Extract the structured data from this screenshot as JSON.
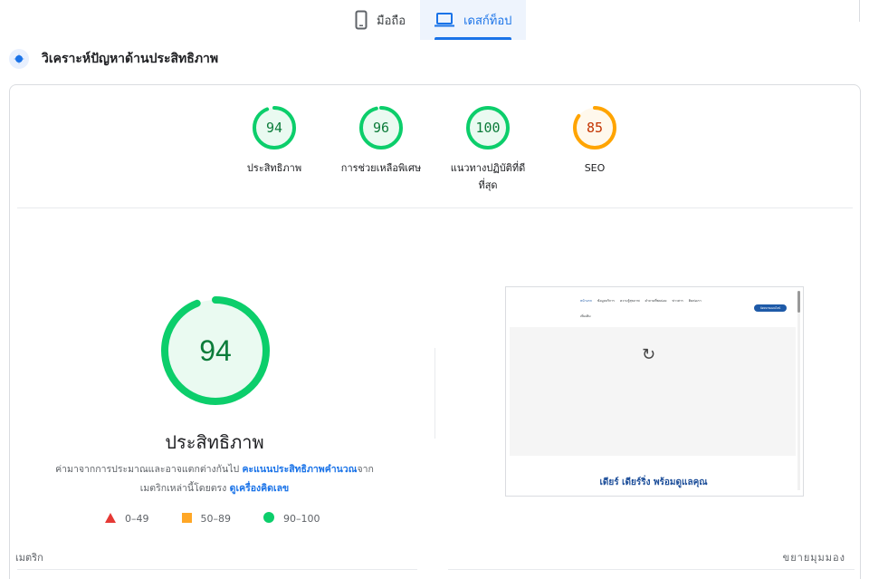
{
  "tabs": [
    {
      "label": "มือถือ",
      "icon": "smartphone-icon",
      "active": false
    },
    {
      "label": "เดสก์ท็อป",
      "icon": "laptop-icon",
      "active": true
    }
  ],
  "section": {
    "title": "วิเคราะห์ปัญหาด้านประสิทธิภาพ",
    "icon": "diagnostics-icon"
  },
  "categories": [
    {
      "score": "94",
      "label": "ประสิทธิภาพ",
      "value": 94,
      "color": "#0cce6b",
      "text_color": "#0c7c3a"
    },
    {
      "score": "96",
      "label": "การช่วยเหลือพิเศษ",
      "value": 96,
      "color": "#0cce6b",
      "text_color": "#0c7c3a"
    },
    {
      "score": "100",
      "label_line1": "แนวทางปฏิบัติที่ดี",
      "label_line2": "ที่สุด",
      "value": 100,
      "color": "#0cce6b",
      "text_color": "#0c7c3a"
    },
    {
      "score": "85",
      "label": "SEO",
      "value": 85,
      "color": "#ffa400",
      "text_color": "#c33300"
    }
  ],
  "performance": {
    "score": "94",
    "value": 94,
    "title": "ประสิทธิภาพ",
    "desc_part1": "ค่ามาจากการประมาณและอาจแตกต่างกันไป ",
    "desc_link1": "คะแนนประสิทธิภาพคำนวณ",
    "desc_part2": "จาก",
    "desc_part3": "เมตริกเหล่านี้โดยตรง ",
    "desc_link2": "ดูเครื่องคิดเลข"
  },
  "legend": [
    {
      "range": "0–49",
      "shape": "triangle",
      "color": "#e53935"
    },
    {
      "range": "50–89",
      "shape": "square",
      "color": "#ffa726"
    },
    {
      "range": "90–100",
      "shape": "circle",
      "color": "#0cce6b"
    }
  ],
  "preview": {
    "caption": "เดียร์ เดียร์ริ่ง พร้อมดูแลคุณ",
    "nav_items": [
      "หน้าแรก",
      "ข้อมูลบริการ",
      "ความรู้สุขภาพ",
      "คำถามที่พบบ่อย",
      "ข่าวสาร",
      "ติดต่อเรา"
    ],
    "nav_more": "เพิ่มเติม",
    "cta": "นัดหมายออนไลน์"
  },
  "metrics": {
    "label": "เมตริก",
    "expand_label": "ขยายมุมมอง"
  }
}
